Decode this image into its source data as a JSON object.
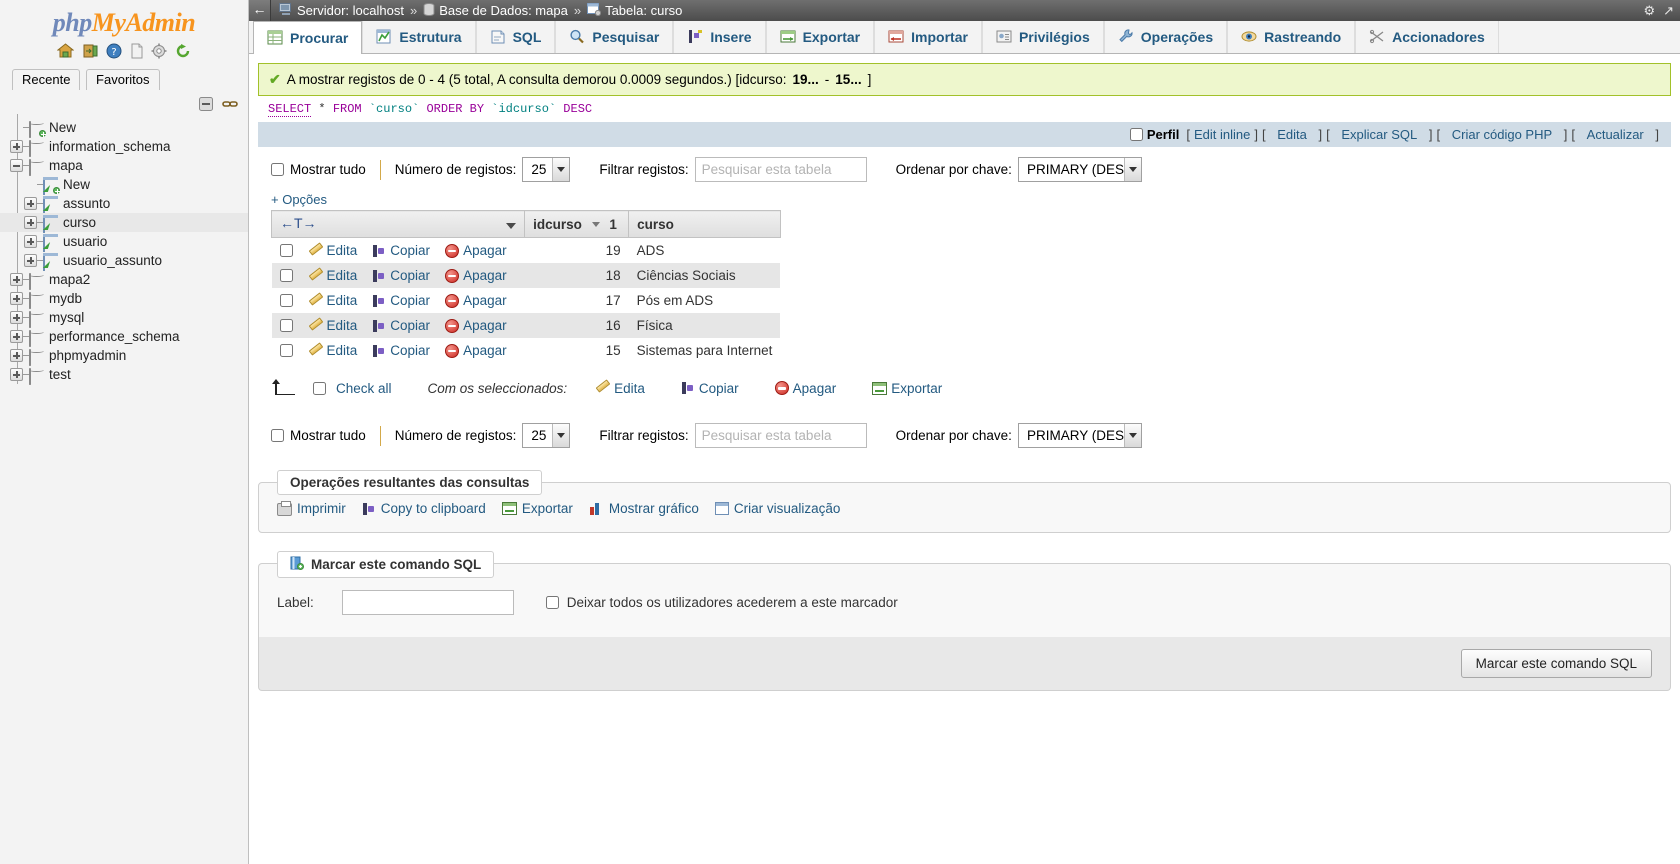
{
  "app": {
    "logo_php": "php",
    "logo_my": "My",
    "logo_admin": "Admin"
  },
  "sidebar": {
    "header_icons": [
      "home-icon",
      "logout-icon",
      "help-icon",
      "docs-icon",
      "settings-icon",
      "reload-icon"
    ],
    "tabs": [
      {
        "label": "Recente",
        "name": "recente"
      },
      {
        "label": "Favoritos",
        "name": "favoritos"
      }
    ],
    "collapse_icons": [
      "collapse-all-icon",
      "link-with-main-panel-icon"
    ],
    "tree": [
      {
        "label": "New",
        "level": 0,
        "icon": "new-database-icon",
        "toggle": "none",
        "selected": false
      },
      {
        "label": "information_schema",
        "level": 0,
        "icon": "database-icon",
        "toggle": "plus",
        "selected": false
      },
      {
        "label": "mapa",
        "level": 0,
        "icon": "database-icon",
        "toggle": "minus",
        "selected": false
      },
      {
        "label": "New",
        "level": 1,
        "icon": "new-table-icon",
        "toggle": "none",
        "selected": false
      },
      {
        "label": "assunto",
        "level": 1,
        "icon": "table-icon",
        "toggle": "plus",
        "selected": false
      },
      {
        "label": "curso",
        "level": 1,
        "icon": "table-icon",
        "toggle": "plus",
        "selected": true
      },
      {
        "label": "usuario",
        "level": 1,
        "icon": "table-icon",
        "toggle": "plus",
        "selected": false
      },
      {
        "label": "usuario_assunto",
        "level": 1,
        "icon": "table-icon",
        "toggle": "plus",
        "selected": false
      },
      {
        "label": "mapa2",
        "level": 0,
        "icon": "database-icon",
        "toggle": "plus",
        "selected": false
      },
      {
        "label": "mydb",
        "level": 0,
        "icon": "database-icon",
        "toggle": "plus",
        "selected": false
      },
      {
        "label": "mysql",
        "level": 0,
        "icon": "database-icon",
        "toggle": "plus",
        "selected": false
      },
      {
        "label": "performance_schema",
        "level": 0,
        "icon": "database-icon",
        "toggle": "plus",
        "selected": false
      },
      {
        "label": "phpmyadmin",
        "level": 0,
        "icon": "database-icon",
        "toggle": "plus",
        "selected": false
      },
      {
        "label": "test",
        "level": 0,
        "icon": "database-icon",
        "toggle": "plus",
        "selected": false
      }
    ]
  },
  "breadcrumb": {
    "back_label": "←",
    "server_label": "Servidor: localhost",
    "database_label": "Base de Dados: mapa",
    "table_label": "Tabela: curso",
    "separator": "»",
    "right_icons": [
      "settings-gear-icon",
      "minimize-icon"
    ]
  },
  "tabs": [
    {
      "label": "Procurar",
      "icon": "browse-icon",
      "active": true
    },
    {
      "label": "Estrutura",
      "icon": "structure-icon",
      "active": false
    },
    {
      "label": "SQL",
      "icon": "sql-icon",
      "active": false
    },
    {
      "label": "Pesquisar",
      "icon": "search-icon",
      "active": false
    },
    {
      "label": "Insere",
      "icon": "insert-icon",
      "active": false
    },
    {
      "label": "Exportar",
      "icon": "export-icon",
      "active": false
    },
    {
      "label": "Importar",
      "icon": "import-icon",
      "active": false
    },
    {
      "label": "Privilégios",
      "icon": "privileges-icon",
      "active": false
    },
    {
      "label": "Operações",
      "icon": "operations-icon",
      "active": false
    },
    {
      "label": "Rastreando",
      "icon": "tracking-icon",
      "active": false
    },
    {
      "label": "Accionadores",
      "icon": "triggers-icon",
      "active": false
    }
  ],
  "message": {
    "icon": "success-check-icon",
    "text_before": "A mostrar registos de 0 - 4 (5 total, A consulta demorou 0.0009 segundos.) [idcurso: ",
    "range_start": "19...",
    "dash": " - ",
    "range_end": "15...",
    "text_after": "]"
  },
  "sql": {
    "kw_select": "SELECT",
    "star": "*",
    "kw_from": "FROM",
    "table": "`curso`",
    "kw_orderby": "ORDER BY",
    "column": "`idcurso`",
    "kw_desc": "DESC"
  },
  "sql_actions": {
    "profiling_label": "Perfil",
    "links": [
      {
        "label": "Edit inline",
        "name": "edit-inline-link"
      },
      {
        "label": "Edita",
        "name": "edit-link"
      },
      {
        "label": "Explicar SQL",
        "name": "explain-sql-link"
      },
      {
        "label": "Criar código PHP",
        "name": "create-php-code-link"
      },
      {
        "label": "Actualizar",
        "name": "refresh-link"
      }
    ],
    "bracket_open": "[",
    "bracket_close": "]"
  },
  "options_bar": {
    "show_all_label": "Mostrar tudo",
    "num_rows_label": "Número de registos:",
    "num_rows_value": "25",
    "filter_label": "Filtrar registos:",
    "filter_placeholder": "Pesquisar esta tabela",
    "filter_value": "",
    "sort_label": "Ordenar por chave:",
    "sort_value": "PRIMARY (DESC)"
  },
  "options_toggle": "+ Opções",
  "table_data": {
    "arrows_header": "←T→",
    "columns": [
      {
        "label": "idcurso",
        "sorted": true,
        "sort_order": "1"
      },
      {
        "label": "curso",
        "sorted": false,
        "sort_order": ""
      }
    ],
    "row_actions": [
      {
        "label": "Edita",
        "icon": "pencil-icon"
      },
      {
        "label": "Copiar",
        "icon": "copy-icon"
      },
      {
        "label": "Apagar",
        "icon": "delete-icon"
      }
    ],
    "rows": [
      {
        "idcurso": "19",
        "curso": "ADS"
      },
      {
        "idcurso": "18",
        "curso": "Ciências Sociais"
      },
      {
        "idcurso": "17",
        "curso": "Pós em ADS"
      },
      {
        "idcurso": "16",
        "curso": "Física"
      },
      {
        "idcurso": "15",
        "curso": "Sistemas para Internet"
      }
    ]
  },
  "bulk_actions": {
    "check_all_label": "Check all",
    "with_selected_label": "Com os seleccionados:",
    "actions": [
      {
        "label": "Edita",
        "icon": "pencil-icon"
      },
      {
        "label": "Copiar",
        "icon": "copy-icon"
      },
      {
        "label": "Apagar",
        "icon": "delete-icon"
      },
      {
        "label": "Exportar",
        "icon": "export-icon"
      }
    ]
  },
  "query_results_panel": {
    "legend": "Operações resultantes das consultas",
    "links": [
      {
        "label": "Imprimir",
        "icon": "print-icon"
      },
      {
        "label": "Copy to clipboard",
        "icon": "copy-icon"
      },
      {
        "label": "Exportar",
        "icon": "export-icon"
      },
      {
        "label": "Mostrar gráfico",
        "icon": "chart-icon"
      },
      {
        "label": "Criar visualização",
        "icon": "create-view-icon"
      }
    ]
  },
  "bookmark_panel": {
    "legend": "Marcar este comando SQL",
    "legend_icon": "bookmark-icon",
    "label_text": "Label:",
    "label_value": "",
    "share_checkbox_label": "Deixar todos os utilizadores acederem a este marcador",
    "submit_label": "Marcar este comando SQL"
  },
  "colors": {
    "accent": "#235a81",
    "success_bg": "#eef7cd",
    "success_border": "#a2c12a",
    "sql_footer_bg": "#d0dce6",
    "brand_orange": "#f7941e",
    "brand_blue": "#7089ba"
  }
}
